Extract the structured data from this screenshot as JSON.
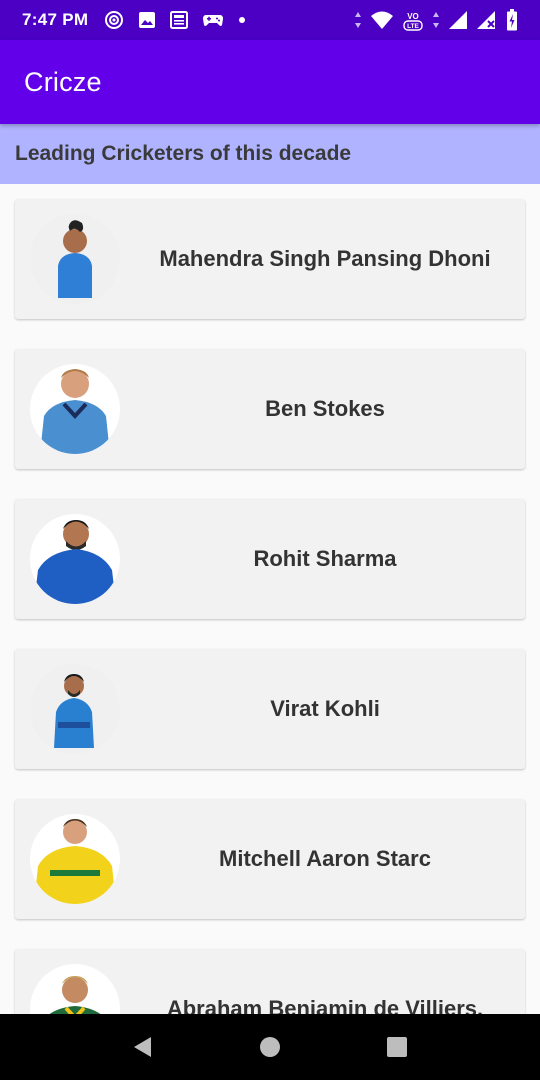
{
  "status_bar": {
    "time": "7:47 PM",
    "left_icons": [
      "radio-icon",
      "image-icon",
      "news-icon",
      "game-icon",
      "dot-icon"
    ],
    "right_icons": [
      "wifi-icon",
      "volte-icon",
      "signal-icon",
      "signal-no-data-icon",
      "battery-icon"
    ],
    "volte_label": "VO LTE"
  },
  "app_bar": {
    "title": "Cricze",
    "color": "#6200ea"
  },
  "section": {
    "title": "Leading Cricketers of this decade",
    "color": "#b0b3ff"
  },
  "players": [
    {
      "name": "Mahendra Singh Pansing Dhoni",
      "jersey": "#2f7fd6",
      "skin": "#a86d4a"
    },
    {
      "name": "Ben Stokes",
      "jersey": "#4a8fd0",
      "skin": "#d9a07e"
    },
    {
      "name": "Rohit Sharma",
      "jersey": "#1f5fc4",
      "skin": "#b27651"
    },
    {
      "name": "Virat Kohli",
      "jersey": "#2a80d0",
      "skin": "#a86d4a"
    },
    {
      "name": "Mitchell Aaron Starc",
      "jersey": "#f2d21a",
      "skin": "#d9a07e"
    },
    {
      "name": "Abraham Benjamin de Villiers.",
      "jersey": "#1f6a3a",
      "skin": "#c48b63"
    }
  ],
  "nav_bar": {
    "buttons": [
      "back-button",
      "home-button",
      "recents-button"
    ]
  }
}
